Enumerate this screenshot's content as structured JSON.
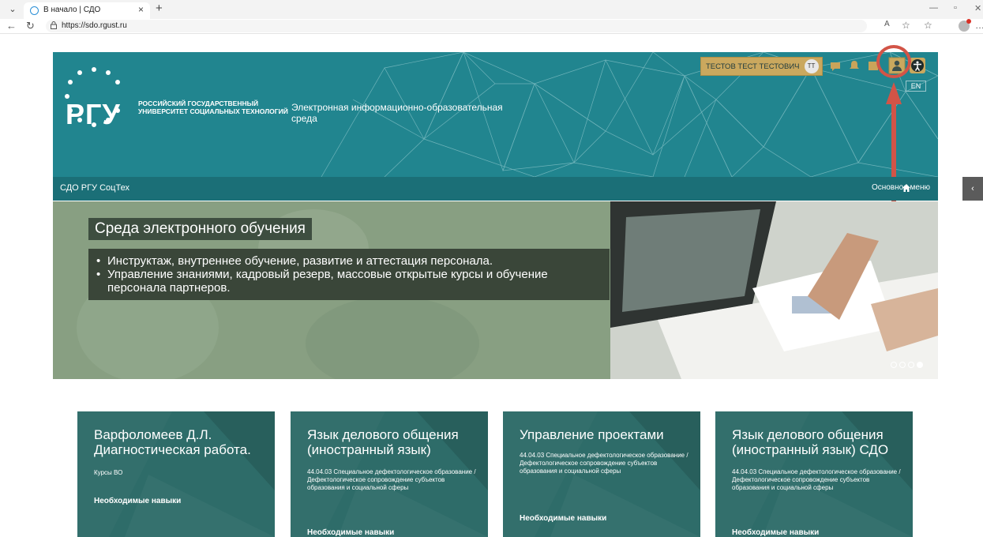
{
  "browser": {
    "tab_title": "В начало | СДО",
    "url": "https://sdo.rgust.ru"
  },
  "header": {
    "logo": "РГУ",
    "university_name": "РОССИЙСКИЙ ГОСУДАРСТВЕННЫЙ УНИВЕРСИТЕТ СОЦИАЛЬНЫХ ТЕХНОЛОГИЙ",
    "site_description": "Электронная информационно-образовательная среда",
    "user_name": "ТЕСТОВ ТЕСТ ТЕСТОВИЧ",
    "user_initials": "ТТ",
    "language": "EN",
    "accent_color": "#21858f"
  },
  "nav": {
    "site_name": "СДО РГУ СоцТех",
    "main_menu": "Основное меню"
  },
  "banner": {
    "title": "Среда электронного обучения",
    "bullets": [
      "Инструктаж, внутреннее обучение, развитие и аттестация персонала.",
      "Управление знаниями, кадровый резерв, массовые открытые курсы и обучение персонала партнеров."
    ]
  },
  "cards": [
    {
      "title": "Варфоломеев Д.Л. Диагностическая работа.",
      "category": "Курсы ВО",
      "skills": "Необходимые навыки"
    },
    {
      "title": "Язык делового общения (иностранный язык)",
      "category": "44.04.03 Специальное дефектологическое образование / Дефектологическое сопровождение субъектов образования и социальной сферы",
      "skills": "Необходимые навыки"
    },
    {
      "title": "Управление проектами",
      "category": "44.04.03 Специальное дефектологическое образование / Дефектологическое сопровождение субъектов образования и социальной сферы",
      "skills": "Необходимые навыки"
    },
    {
      "title": "Язык делового общения (иностранный язык) СДО",
      "category": "44.04.03 Специальное дефектологическое образование / Дефектологическое сопровождение субъектов образования и социальной сферы",
      "skills": "Необходимые навыки"
    }
  ]
}
